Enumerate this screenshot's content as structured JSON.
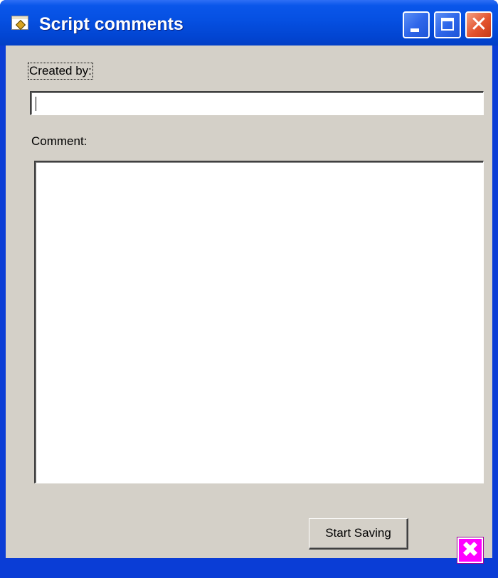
{
  "window": {
    "title": "Script comments"
  },
  "titlebar_buttons": {
    "minimize_icon": "minimize-icon",
    "maximize_icon": "maximize-icon",
    "close_icon": "close-icon",
    "close_glyph": "✕"
  },
  "form": {
    "created_by_label": "Created by:",
    "created_by_value": "",
    "comment_label": "Comment:",
    "comment_value": "",
    "start_saving_label": "Start Saving"
  },
  "status_icon": {
    "glyph": "✖",
    "icon": "magenta-x-icon",
    "color": "#ff00ff"
  },
  "colors": {
    "titlebar": "#0651e3",
    "client_background": "#d4d0c8",
    "close_button": "#e3532e"
  }
}
